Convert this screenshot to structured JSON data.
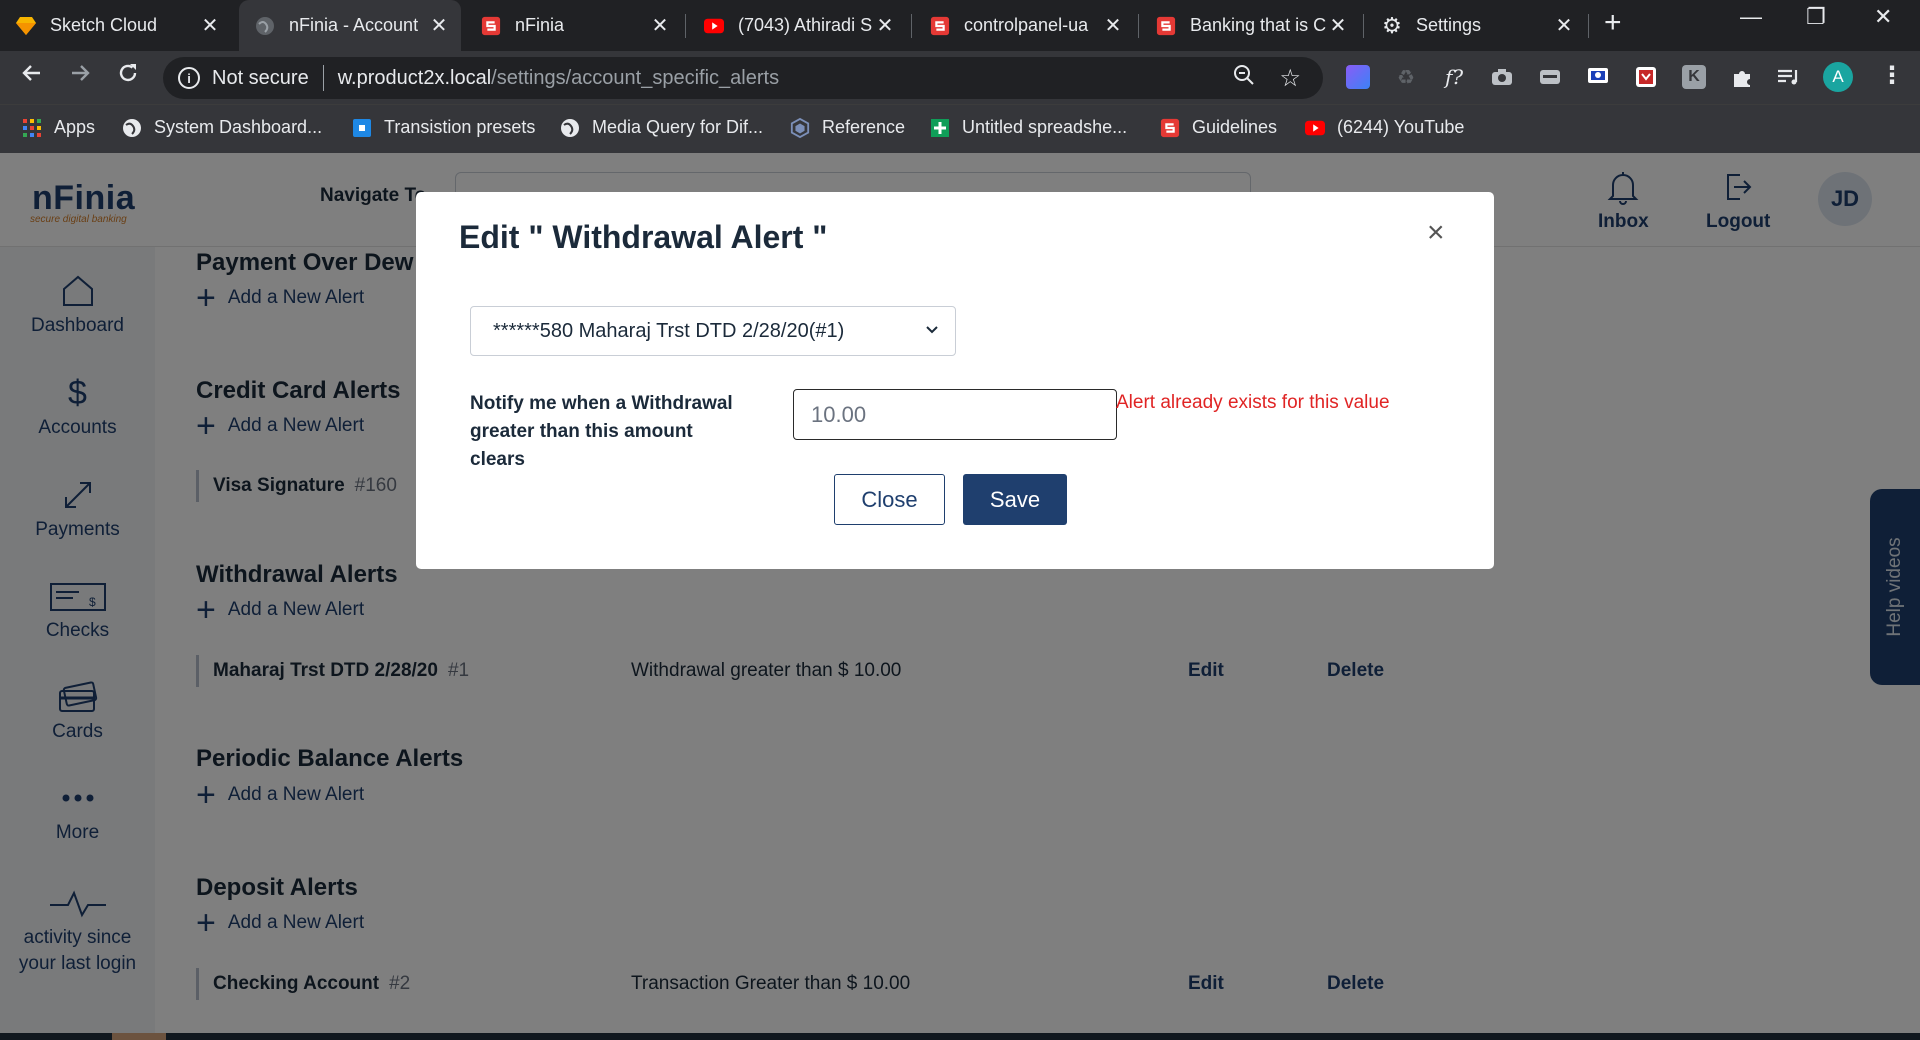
{
  "browser": {
    "tabs": [
      {
        "title": "Sketch Cloud",
        "icon": "sketch-diamond-icon",
        "active": false
      },
      {
        "title": "nFinia - Account",
        "icon": "globe-icon",
        "active": true
      },
      {
        "title": "nFinia",
        "icon": "red-s-icon",
        "active": false
      },
      {
        "title": "(7043) Athiradi S",
        "icon": "youtube-icon",
        "active": false
      },
      {
        "title": "controlpanel-ua",
        "icon": "red-s-icon",
        "active": false
      },
      {
        "title": "Banking that is C",
        "icon": "red-s-icon",
        "active": false
      },
      {
        "title": "Settings",
        "icon": "gear-icon",
        "active": false
      }
    ],
    "omnibox": {
      "security": "Not secure",
      "host": "w.product2x.local",
      "path": "/settings/account_specific_alerts"
    },
    "profile_initial": "A",
    "bookmarks": [
      {
        "label": "Apps",
        "icon": "apps-grid-icon"
      },
      {
        "label": "System Dashboard...",
        "icon": "globe-icon"
      },
      {
        "label": "Transistion presets",
        "icon": "blue-square-icon"
      },
      {
        "label": "Media Query for Dif...",
        "icon": "globe-icon"
      },
      {
        "label": "Reference",
        "icon": "hexagon-icon"
      },
      {
        "label": "Untitled spreadshe...",
        "icon": "sheets-plus-icon"
      },
      {
        "label": "Guidelines",
        "icon": "red-s-icon"
      },
      {
        "label": "(6244) YouTube",
        "icon": "youtube-icon"
      }
    ]
  },
  "app": {
    "logo": "nFinia",
    "logo_tagline": "secure digital banking",
    "navigate_label": "Navigate To",
    "header": {
      "inbox_label": "Inbox",
      "logout_label": "Logout",
      "avatar_initials": "JD"
    },
    "sidebar": [
      {
        "label": "Dashboard",
        "icon": "home-icon"
      },
      {
        "label": "Accounts",
        "icon": "dollar-icon"
      },
      {
        "label": "Payments",
        "icon": "diagonal-arrows-icon"
      },
      {
        "label": "Checks",
        "icon": "check-icon"
      },
      {
        "label": "Cards",
        "icon": "cards-icon"
      },
      {
        "label": "More",
        "icon": "dots-icon"
      },
      {
        "label": "activity since your last login",
        "icon": "pulse-icon"
      }
    ],
    "sections": [
      {
        "title": "Payment Over Dew",
        "add_label": "Add a New Alert"
      },
      {
        "title": "Credit Card Alerts",
        "add_label": "Add a New Alert",
        "rows": [
          {
            "name": "Visa Signature",
            "num": "#160"
          }
        ]
      },
      {
        "title": "Withdrawal Alerts",
        "add_label": "Add a New Alert",
        "rows": [
          {
            "name": "Maharaj Trst DTD 2/28/20",
            "num": "#1",
            "desc": "Withdrawal greater than $ 10.00",
            "edit": "Edit",
            "delete": "Delete"
          }
        ]
      },
      {
        "title": "Periodic Balance Alerts",
        "add_label": "Add a New Alert"
      },
      {
        "title": "Deposit Alerts",
        "add_label": "Add a New Alert",
        "rows": [
          {
            "name": "Checking Account",
            "num": "#2",
            "desc": "Transaction Greater than $ 10.00",
            "edit": "Edit",
            "delete": "Delete"
          }
        ]
      }
    ],
    "help_tab": "Help videos"
  },
  "modal": {
    "title": "Edit \" Withdrawal Alert \"",
    "close_icon": "×",
    "account_select": "******580 Maharaj Trst DTD 2/28/20(#1)",
    "notify_label": "Notify me when a Withdrawal greater than this amount clears",
    "amount_value": "10.00",
    "error": "Alert already exists for this value",
    "close_button": "Close",
    "save_button": "Save"
  },
  "colors": {
    "brand_navy": "#1f3f6e",
    "error_red": "#e02424",
    "chrome_dark": "#202124"
  }
}
